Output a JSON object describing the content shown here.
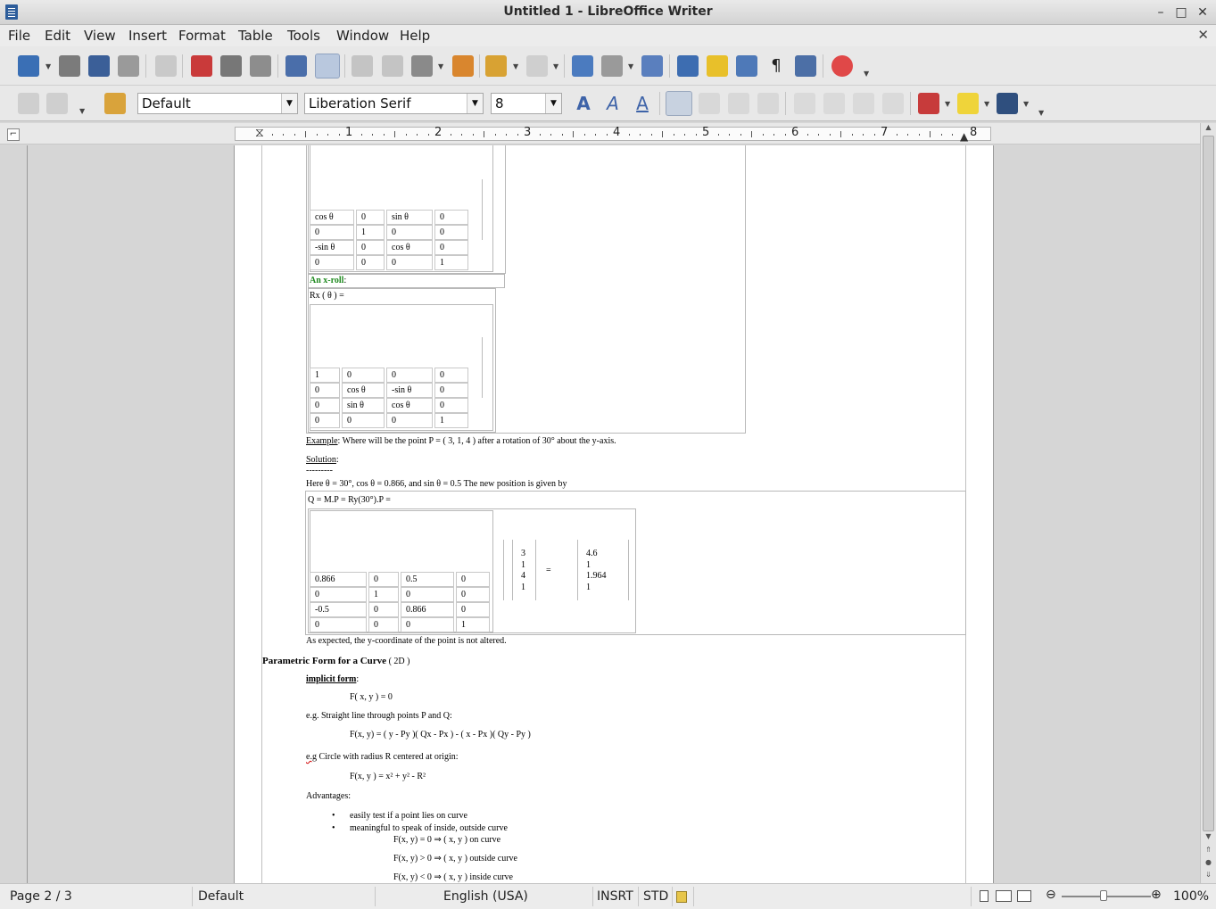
{
  "window": {
    "title": "Untitled 1 - LibreOffice Writer",
    "minimize": "–",
    "maximize": "□",
    "close": "✕"
  },
  "menu": {
    "items": [
      "File",
      "Edit",
      "View",
      "Insert",
      "Format",
      "Table",
      "Tools",
      "Window",
      "Help"
    ],
    "doc_close": "✕"
  },
  "formatting": {
    "paragraph_style": "Default",
    "font_name": "Liberation Serif",
    "font_size": "8"
  },
  "ruler": {
    "numbers": [
      "1",
      "2",
      "3",
      "4",
      "5",
      "6",
      "7",
      "8"
    ]
  },
  "document": {
    "matrix_y": {
      "rows": [
        [
          "cos θ",
          "0",
          "sin θ",
          "0"
        ],
        [
          "0",
          "1",
          "0",
          "0"
        ],
        [
          "-sin θ",
          "0",
          "cos θ",
          "0"
        ],
        [
          "0",
          "0",
          "0",
          "1"
        ]
      ]
    },
    "x_roll_label": "An x-roll",
    "x_roll_colon": ":",
    "rx_formula": "Rx ( θ ) =",
    "matrix_x": {
      "rows": [
        [
          "1",
          "0",
          "0",
          "0"
        ],
        [
          "0",
          "cos θ",
          "-sin θ",
          "0"
        ],
        [
          "0",
          "sin θ",
          "cos θ",
          "0"
        ],
        [
          "0",
          "0",
          "0",
          "1"
        ]
      ]
    },
    "example_label": "Example",
    "example_text": ": Where will be the point P = ( 3, 1, 4 ) after a rotation of 30° about the y-axis.",
    "solution_label": "Solution",
    "solution_colon": ":",
    "solution_rule": "---------",
    "here_text": "Here θ = 30°, cos θ = 0.866, and sin θ = 0.5 The new position is given by",
    "q_formula": "Q = M.P = Ry(30°).P =",
    "matrix_m": {
      "rows": [
        [
          "0.866",
          "0",
          "0.5",
          "0"
        ],
        [
          "0",
          "1",
          "0",
          "0"
        ],
        [
          "-0.5",
          "0",
          "0.866",
          "0"
        ],
        [
          "0",
          "0",
          "0",
          "1"
        ]
      ]
    },
    "vector_p": [
      "3",
      "1",
      "4",
      "1"
    ],
    "equals": "=",
    "vector_q": [
      "4.6",
      "1",
      "1.964",
      "1"
    ],
    "expected_text": "As expected, the y-coordinate of the point is not altered.",
    "parametric_heading": "Parametric Form for a Curve",
    "parametric_suffix": "( 2D )",
    "implicit_label": "implicit form",
    "implicit_colon": ":",
    "implicit_eq": "F( x, y ) = 0",
    "eg_line": "e.g. Straight line through points P and Q:",
    "line_eq": "F(x, y) = ( y - Py )( Qx - Px ) - ( x - Px )( Qy - Py )",
    "eg_label": "e.g",
    "eg_circle": " Circle with radius R centered at origin:",
    "circle_eq": "F(x, y ) = x² + y² - R²",
    "advantages": "Advantages:",
    "bullet1": "easily test if a point lies on curve",
    "bullet2": "meaningful to speak of inside, outside curve",
    "cond1": "F(x, y) = 0 ⇒ ( x, y ) on curve",
    "cond2": "F(x, y) > 0 ⇒ ( x, y ) outside curve",
    "cond3": "F(x, y) < 0 ⇒ ( x, y ) inside curve"
  },
  "status": {
    "page": "Page 2 / 3",
    "style": "Default",
    "language": "English (USA)",
    "insert_mode": "INSRT",
    "selection_mode": "STD",
    "zoom": "100%"
  }
}
